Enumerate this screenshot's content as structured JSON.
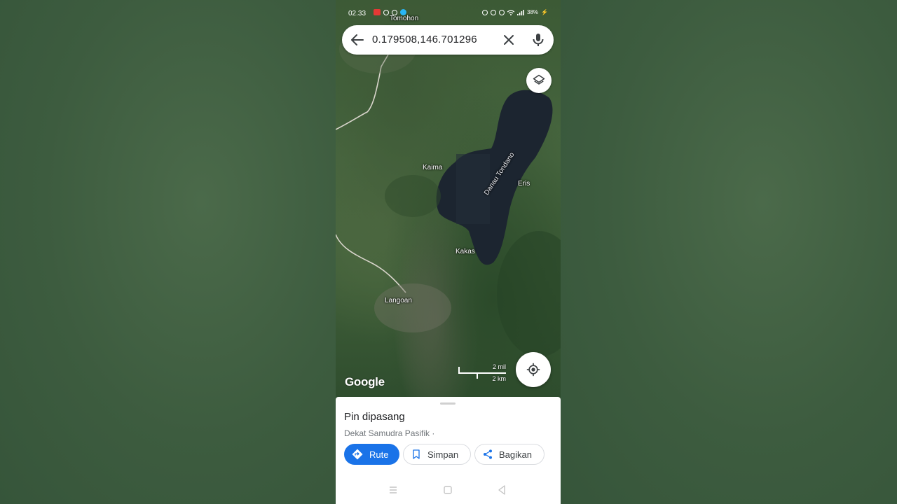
{
  "status_bar": {
    "time": "02.33",
    "battery": "38%"
  },
  "search": {
    "query": "0.179508,146.701296"
  },
  "map": {
    "labels": {
      "tomohon": "Tomohon",
      "kaima": "Kaima",
      "lake": "Danau Tondano",
      "eris": "Eris",
      "kakas": "Kakas",
      "langoan": "Langoan"
    },
    "attribution": "Google",
    "scale": {
      "imperial": "2 mil",
      "metric": "2 km"
    }
  },
  "sheet": {
    "title": "Pin dipasang",
    "subtitle": "Dekat Samudra Pasifik ·",
    "actions": {
      "route": "Rute",
      "save": "Simpan",
      "share": "Bagikan"
    }
  },
  "colors": {
    "accent": "#1a73e8",
    "map_water": "#1c2530"
  },
  "icons": {
    "back": "arrow-left-icon",
    "clear": "close-icon",
    "mic": "microphone-icon",
    "layers": "layers-icon",
    "locate": "my-location-icon",
    "route": "directions-icon",
    "save": "bookmark-icon",
    "share": "share-icon"
  }
}
